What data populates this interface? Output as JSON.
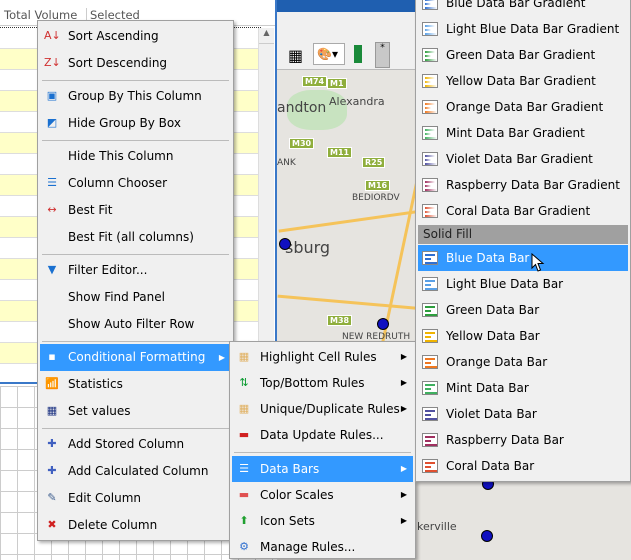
{
  "grid": {
    "columns": [
      "Total Volume",
      "Selected"
    ]
  },
  "map": {
    "labels": [
      "andton",
      "Alexandra",
      "BEDIORDV",
      "NEW REDRUTH",
      "Walkerville",
      "sburg",
      "ANK"
    ],
    "shields": [
      "M74",
      "M1",
      "M30",
      "M11",
      "R25",
      "M16",
      "M38"
    ]
  },
  "main_menu": {
    "items": [
      {
        "label": "Sort Ascending",
        "icon": "sort-ascending-icon"
      },
      {
        "label": "Sort Descending",
        "icon": "sort-descending-icon"
      },
      {
        "sep": true
      },
      {
        "label": "Group By This Column",
        "icon": "group-by-icon"
      },
      {
        "label": "Hide Group By Box",
        "icon": "hide-group-box-icon"
      },
      {
        "sep": true
      },
      {
        "label": "Hide This Column"
      },
      {
        "label": "Column Chooser",
        "icon": "column-chooser-icon"
      },
      {
        "label": "Best Fit",
        "icon": "best-fit-icon"
      },
      {
        "label": "Best Fit (all columns)"
      },
      {
        "sep": true
      },
      {
        "label": "Filter Editor...",
        "icon": "filter-icon"
      },
      {
        "label": "Show Find Panel"
      },
      {
        "label": "Show Auto Filter Row"
      },
      {
        "sep": true
      },
      {
        "label": "Conditional Formatting",
        "icon": "conditional-formatting-icon",
        "submenu": true,
        "highlighted": true
      },
      {
        "label": "Statistics",
        "icon": "statistics-icon"
      },
      {
        "label": "Set values",
        "icon": "set-values-icon"
      },
      {
        "sep": true
      },
      {
        "label": "Add Stored Column",
        "icon": "plus-icon"
      },
      {
        "label": "Add Calculated Column",
        "icon": "plus-icon"
      },
      {
        "label": "Edit Column",
        "icon": "edit-icon"
      },
      {
        "label": "Delete Column",
        "icon": "delete-icon"
      }
    ]
  },
  "cf_menu": {
    "items": [
      {
        "label": "Highlight Cell Rules",
        "icon": "highlight-cells-icon",
        "submenu": true
      },
      {
        "label": "Top/Bottom Rules",
        "icon": "top-bottom-icon",
        "submenu": true
      },
      {
        "label": "Unique/Duplicate Rules",
        "icon": "unique-duplicate-icon",
        "submenu": true
      },
      {
        "label": "Data Update Rules...",
        "icon": "data-update-icon"
      },
      {
        "sep": true
      },
      {
        "label": "Data Bars",
        "icon": "data-bars-icon",
        "submenu": true,
        "highlighted": true
      },
      {
        "label": "Color Scales",
        "icon": "color-scales-icon",
        "submenu": true
      },
      {
        "label": "Icon Sets",
        "icon": "icon-sets-icon",
        "submenu": true
      },
      {
        "label": "Manage Rules...",
        "icon": "manage-rules-icon"
      }
    ]
  },
  "databar_menu": {
    "gradient": [
      {
        "label": "Blue Data Bar Gradient",
        "color": "#2f6fd0"
      },
      {
        "label": "Light Blue Data Bar Gradient",
        "color": "#5aa0e6"
      },
      {
        "label": "Green Data Bar Gradient",
        "color": "#2e9e3e"
      },
      {
        "label": "Yellow Data Bar Gradient",
        "color": "#f0b400"
      },
      {
        "label": "Orange Data Bar Gradient",
        "color": "#f07820"
      },
      {
        "label": "Mint Data Bar Gradient",
        "color": "#40b060"
      },
      {
        "label": "Violet Data Bar Gradient",
        "color": "#5050a0"
      },
      {
        "label": "Raspberry Data Bar Gradient",
        "color": "#a03060"
      },
      {
        "label": "Coral Data Bar Gradient",
        "color": "#e05030"
      }
    ],
    "section": "Solid Fill",
    "solid": [
      {
        "label": "Blue Data Bar",
        "color": "#2f6fd0",
        "highlighted": true
      },
      {
        "label": "Light Blue Data Bar",
        "color": "#5aa0e6"
      },
      {
        "label": "Green Data Bar",
        "color": "#2e9e3e"
      },
      {
        "label": "Yellow Data Bar",
        "color": "#f0b400"
      },
      {
        "label": "Orange Data Bar",
        "color": "#f07820"
      },
      {
        "label": "Mint Data Bar",
        "color": "#40b060"
      },
      {
        "label": "Violet Data Bar",
        "color": "#5050a0"
      },
      {
        "label": "Raspberry Data Bar",
        "color": "#a03060"
      },
      {
        "label": "Coral Data Bar",
        "color": "#e05030"
      }
    ]
  },
  "colors": {
    "highlight": "#3399ff",
    "row_alt": "#ffffc8"
  }
}
